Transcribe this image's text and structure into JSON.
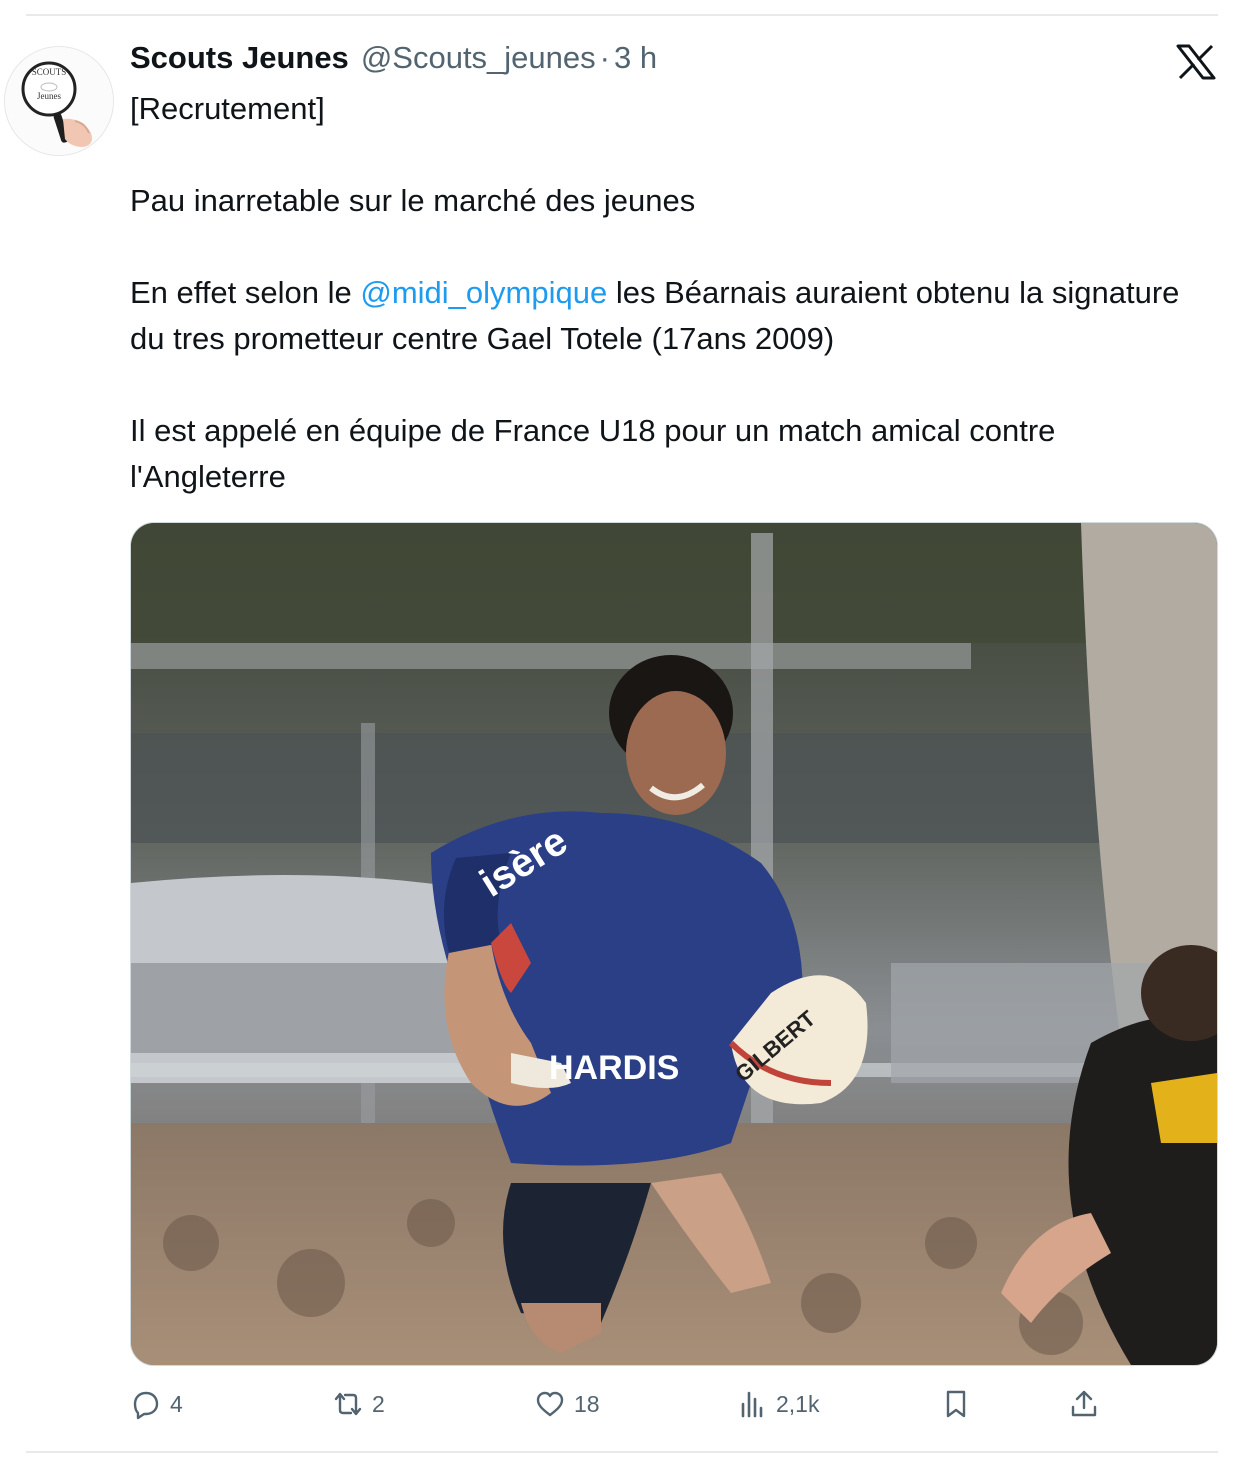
{
  "tweet": {
    "author_name": "Scouts Jeunes",
    "handle": "@Scouts_jeunes",
    "separator": "·",
    "time": "3 h",
    "avatar_text_top": "SCOUTS",
    "avatar_text_bottom": "Jeunes",
    "line1": "[Recrutement]",
    "line2": "Pau inarretable sur le marché des jeunes",
    "line3_prefix": "En effet selon le ",
    "mention": "@midi_olympique",
    "line3_suffix": " les Béarnais auraient obtenu la signature du tres prometteur centre Gael Totele (17ans 2009)",
    "line4": "Il est appelé en équipe de France U18 pour un match amical contre l'Angleterre"
  },
  "media": {
    "jersey_text": "isère",
    "sponsor_text": "HARDIS",
    "ball_text": "GILBERT"
  },
  "actions": {
    "replies": "4",
    "reposts": "2",
    "likes": "18",
    "views": "2,1k"
  },
  "icons": {
    "reply": "reply-icon",
    "repost": "repost-icon",
    "like": "heart-icon",
    "views": "views-icon",
    "bookmark": "bookmark-icon",
    "share": "share-icon",
    "brand": "x-logo-icon"
  },
  "colors": {
    "text": "#0f1419",
    "secondary": "#536471",
    "link": "#1d9bf0",
    "divider": "#e7e9ea"
  }
}
